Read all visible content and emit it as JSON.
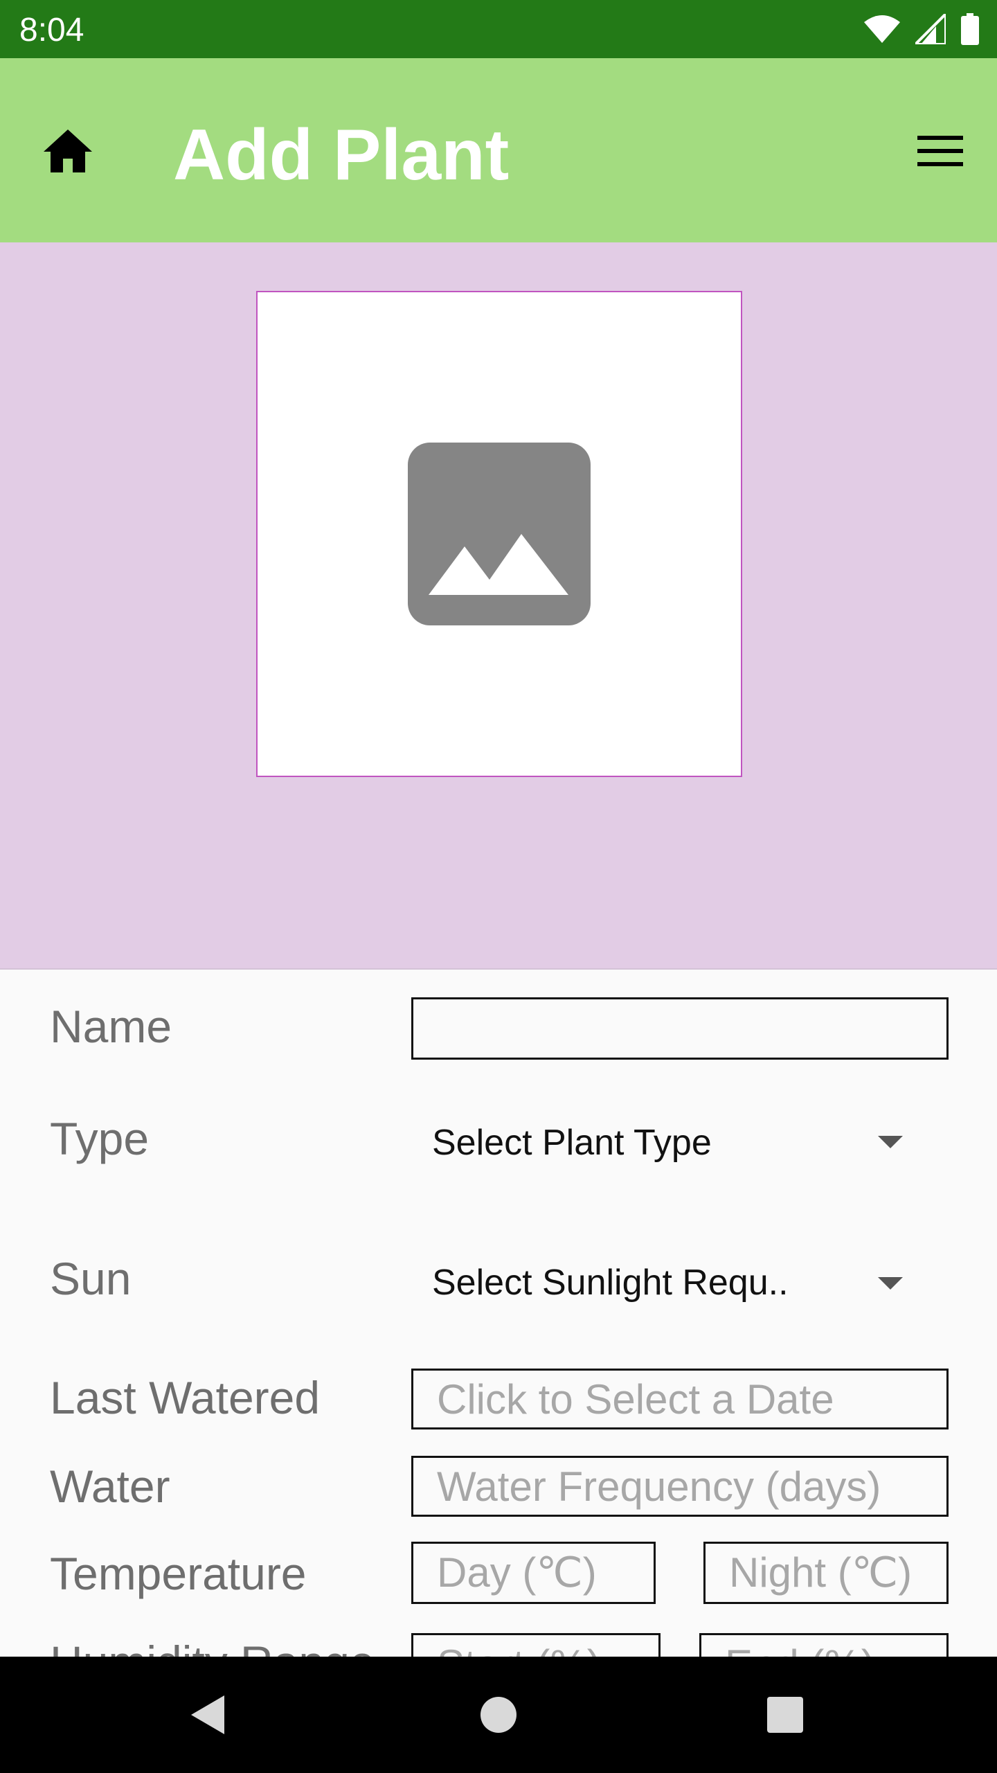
{
  "status_bar": {
    "time": "8:04",
    "icons": [
      "wifi-icon",
      "cell-signal-icon",
      "battery-icon"
    ]
  },
  "app_bar": {
    "title": "Add Plant",
    "left_icon": "home-icon",
    "right_icon": "menu-icon",
    "background": "#A3DC80"
  },
  "image_picker": {
    "icon": "image-placeholder-icon",
    "background": "#E2CCE5"
  },
  "form": {
    "name": {
      "label": "Name",
      "value": ""
    },
    "type": {
      "label": "Type",
      "selected": "Select Plant Type"
    },
    "sun": {
      "label": "Sun",
      "selected": "Select Sunlight Requ.."
    },
    "last_watered": {
      "label": "Last Watered",
      "placeholder": "Click to Select a Date"
    },
    "water": {
      "label": "Water",
      "placeholder": "Water Frequency (days)"
    },
    "temperature": {
      "label": "Temperature",
      "day_placeholder": "Day (℃)",
      "night_placeholder": "Night (℃)"
    },
    "humidity": {
      "label": "Humidity Range",
      "start_placeholder": "Start (%)",
      "end_placeholder": "End (%)"
    }
  },
  "nav_bar": {
    "buttons": [
      "back-icon",
      "home-circle-icon",
      "recents-icon"
    ]
  },
  "colors": {
    "status_bar": "#237A17",
    "accent": "#C055C0"
  }
}
